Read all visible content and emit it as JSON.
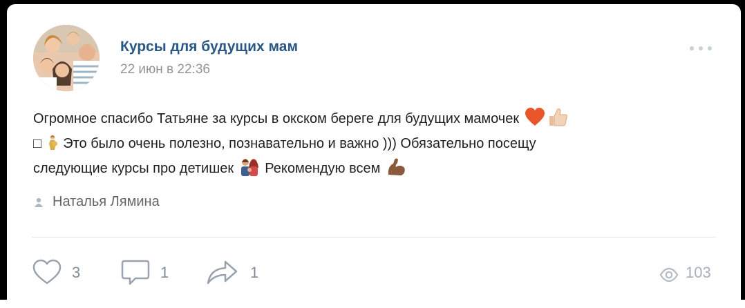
{
  "post": {
    "group_name": "Курсы для будущих мам",
    "date": "22 июн в 22:36",
    "text_line1": "Огромное спасибо Татьяне за курсы в окском береге для будущих мамочек",
    "text_line2_prefix": "□",
    "text_line2": "Это было очень полезно, познавательно и важно ))) Обязательно посещу",
    "text_line3_a": "следующие курсы про детишек",
    "text_line3_b": "Рекомендую всем",
    "emojis": [
      "heart-icon",
      "thumbs-up-icon",
      "pregnant-woman-icon",
      "family-icon",
      "flexed-biceps-icon"
    ],
    "author": "Наталья Лямина"
  },
  "actions": {
    "likes": "3",
    "comments": "1",
    "shares": "1",
    "views": "103"
  },
  "colors": {
    "link": "#2a5885",
    "muted": "#939393",
    "icon": "#818c99",
    "divider": "#e7e8ec"
  }
}
